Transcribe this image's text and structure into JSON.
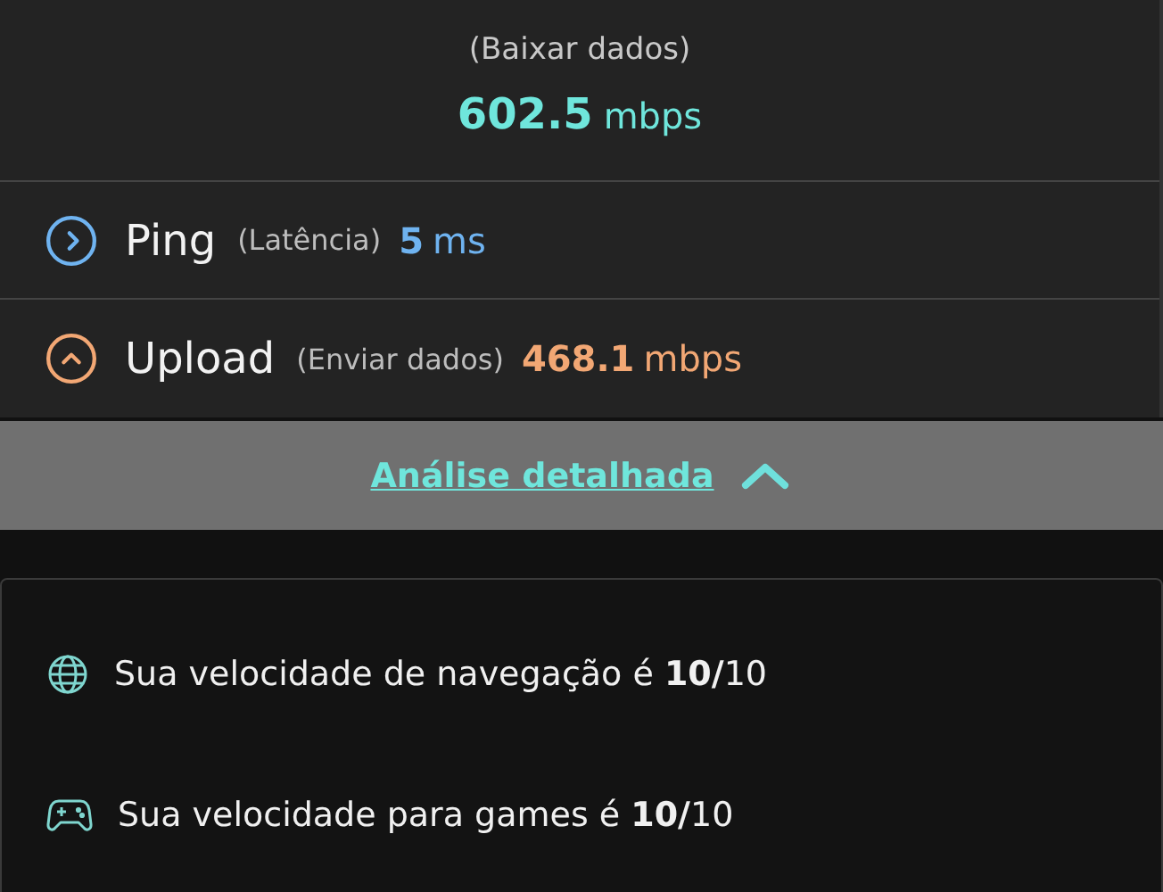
{
  "download": {
    "label": "(Baixar dados)",
    "value": "602.5",
    "unit": "mbps"
  },
  "metrics": [
    {
      "kind": "ping",
      "name": "Ping",
      "label": "(Latência)",
      "value": "5",
      "unit": "ms",
      "color": "#6fb3f0"
    },
    {
      "kind": "upload",
      "name": "Upload",
      "label": "(Enviar dados)",
      "value": "468.1",
      "unit": "mbps",
      "color": "#f2a774"
    }
  ],
  "toggle": {
    "label": "Análise detalhada",
    "expanded": true
  },
  "ratings": [
    {
      "kind": "browsing",
      "text": "Sua velocidade de navegação é **10/**10"
    },
    {
      "kind": "games",
      "text": "Sua velocidade para games é **10/**10"
    }
  ]
}
